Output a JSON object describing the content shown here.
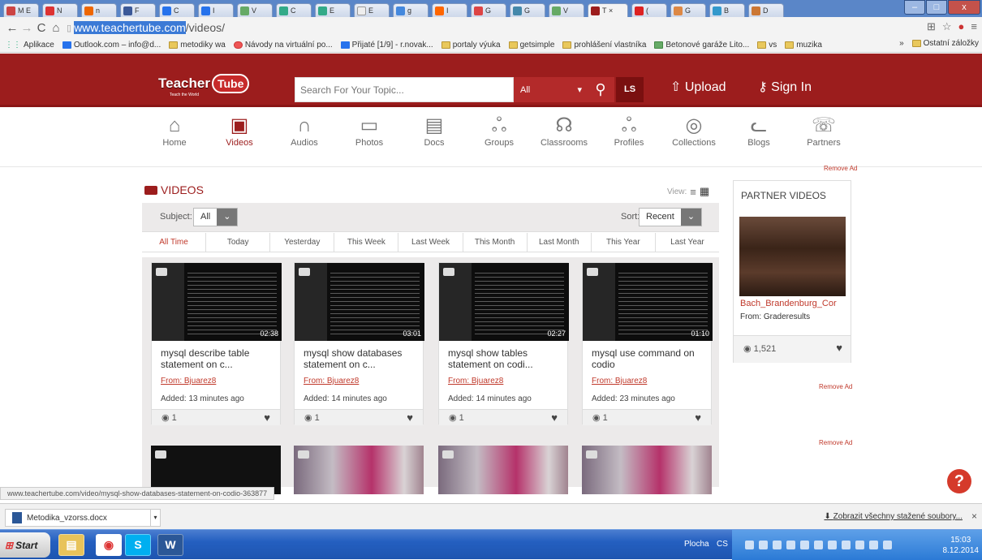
{
  "browser": {
    "tabs": [
      "M E",
      "N",
      "n",
      "F",
      "C",
      "I",
      "V",
      "C",
      "E",
      "E",
      "g",
      "I",
      "G",
      "G",
      "V",
      "T",
      "(",
      "G",
      "B",
      "D"
    ],
    "active_tab": "T",
    "url_host": "www.teachertube.com",
    "url_path": "/videos/",
    "bookmarks": [
      "Aplikace",
      "Outlook.com – info@d...",
      "metodiky wa",
      "Návody na virtuální po...",
      "Přijaté [1/9] - r.novak...",
      "portaly výuka",
      "getsimple",
      "prohlášení vlastníka",
      "Betonové garáže Lito...",
      "vs",
      "muzika"
    ],
    "bookmarks_more": "»",
    "bookmarks_other": "Ostatní záložky"
  },
  "site": {
    "logo_text": "Teacher",
    "logo_badge": "Tube",
    "logo_sub": "Teach the World",
    "search_placeholder": "Search For Your Topic...",
    "search_category": "All",
    "ls_label": "LS",
    "upload_label": "Upload",
    "signin_label": "Sign In",
    "nav": [
      {
        "label": "Home",
        "icon": "⌂"
      },
      {
        "label": "Videos",
        "icon": "▣"
      },
      {
        "label": "Audios",
        "icon": "∩"
      },
      {
        "label": "Photos",
        "icon": "▭"
      },
      {
        "label": "Docs",
        "icon": "▤"
      },
      {
        "label": "Groups",
        "icon": "ஃ"
      },
      {
        "label": "Classrooms",
        "icon": "☊"
      },
      {
        "label": "Profiles",
        "icon": "ஃ"
      },
      {
        "label": "Collections",
        "icon": "◎"
      },
      {
        "label": "Blogs",
        "icon": "ᓚ"
      },
      {
        "label": "Partners",
        "icon": "☏"
      }
    ],
    "active_nav": "Videos",
    "remove_ad": "Remove Ad"
  },
  "videos": {
    "heading": "VIDEOS",
    "view_label": "View:",
    "subject_label": "Subject:",
    "subject_value": "All",
    "sort_label": "Sort:",
    "sort_value": "Recent",
    "time_filters": [
      "All Time",
      "Today",
      "Yesterday",
      "This Week",
      "Last Week",
      "This Month",
      "Last Month",
      "This Year",
      "Last Year"
    ],
    "active_time_filter": "All Time",
    "cards": [
      {
        "title": "mysql describe table statement on c...",
        "from": "From: Bjuarez8",
        "added": "Added: 13 minutes ago",
        "views": "1",
        "duration": "02:38"
      },
      {
        "title": "mysql show databases statement on c...",
        "from": "From: Bjuarez8",
        "added": "Added: 14 minutes ago",
        "views": "1",
        "duration": "03:01"
      },
      {
        "title": "mysql show tables statement on codi...",
        "from": "From: Bjuarez8",
        "added": "Added: 14 minutes ago",
        "views": "1",
        "duration": "02:27"
      },
      {
        "title": "mysql use command on codio",
        "from": "From: Bjuarez8",
        "added": "Added: 23 minutes ago",
        "views": "1",
        "duration": "01:10"
      }
    ]
  },
  "partner": {
    "heading": "PARTNER VIDEOS",
    "title": "Bach_Brandenburg_Cor",
    "from": "From: Graderesults",
    "views": "1,521"
  },
  "status_url": "www.teachertube.com/video/mysql-show-databases-statement-on-codio-363877",
  "downloads": {
    "file": "Metodika_vzorss.docx",
    "show_all": "Zobrazit všechny stažené soubory..."
  },
  "taskbar": {
    "start": "Start",
    "desktop": "Plocha",
    "lang": "CS",
    "time": "15:03",
    "date": "8.12.2014"
  },
  "colors": {
    "brand": "#9c1d1d",
    "accent": "#c0392b"
  }
}
